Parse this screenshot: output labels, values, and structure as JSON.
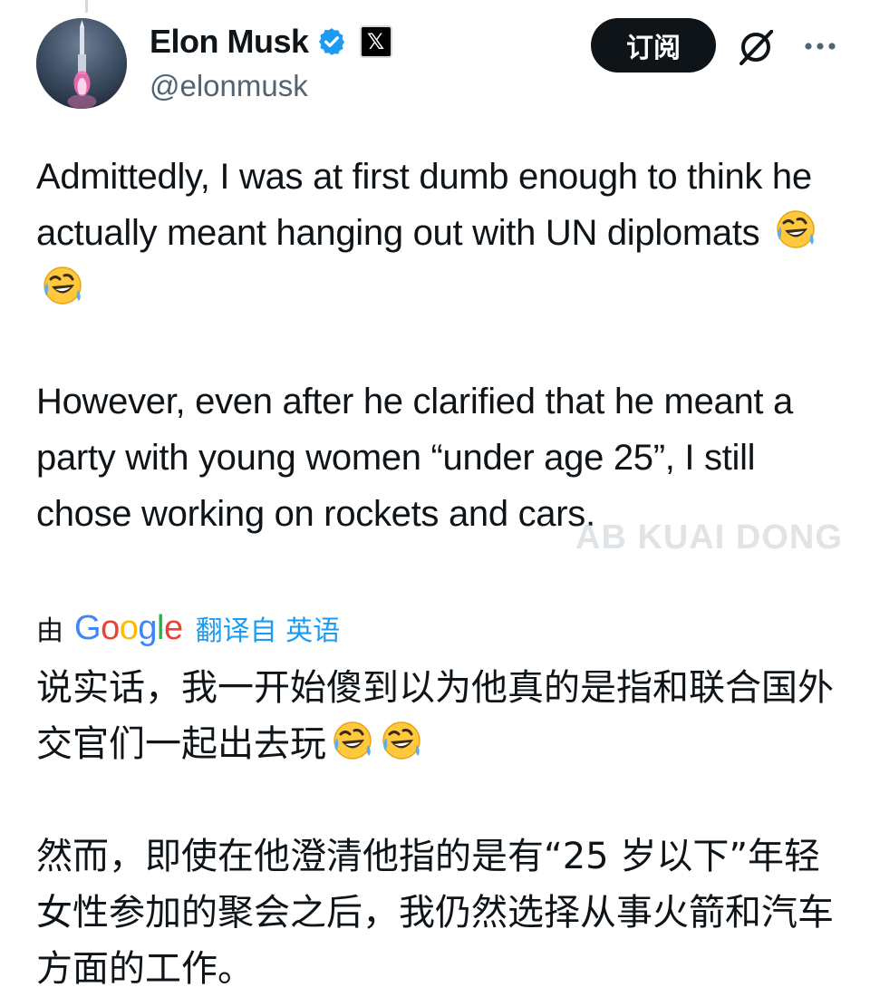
{
  "author": {
    "display_name": "Elon Musk",
    "handle": "@elonmusk",
    "verified_icon": "verified-badge-icon",
    "affiliate_icon": "x-logo-icon",
    "affiliate_glyph": "𝕏"
  },
  "actions": {
    "subscribe_label": "订阅",
    "grok_icon": "grok-icon",
    "more_icon": "more-options-icon"
  },
  "tweet": {
    "paragraph_1": "Admittedly, I was at first dumb enough to think he actually meant hanging out with UN diplomats",
    "paragraph_2": "However, even after he clarified that he meant a party with young women “under age 25”, I still chose working on rockets and cars.",
    "emoji": "rolling-on-floor-laughing"
  },
  "translation": {
    "by_label": "由",
    "provider": "Google",
    "link_label": "翻译自 英语",
    "paragraph_1": "说实话，我一开始傻到以为他真的是指和联合国外交官们一起出去玩",
    "paragraph_2": "然而，即使在他澄清他指的是有“25 岁以下”年轻女性参加的聚会之后，我仍然选择从事火箭和汽车方面的工作。"
  },
  "watermark": "AB KUAI DONG",
  "colors": {
    "text": "#0f1419",
    "secondary": "#536471",
    "link": "#1d9bf0",
    "verified": "#1d9bf0",
    "button_bg": "#0f1419"
  }
}
